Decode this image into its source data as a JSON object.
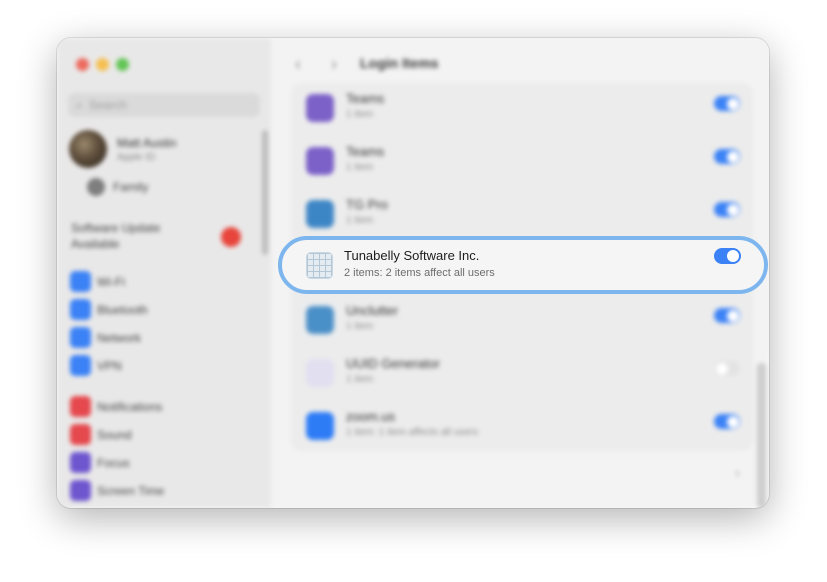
{
  "window": {
    "title": "Login Items"
  },
  "sidebar": {
    "search_placeholder": "Search",
    "account": {
      "name": "Matt Austin",
      "subtitle": "Apple ID"
    },
    "family": "Family",
    "update_text": "Software Update Available",
    "sections": [
      [
        {
          "label": "Wi-Fi",
          "icon": "wifi-icon",
          "color": "#3b82f6"
        },
        {
          "label": "Bluetooth",
          "icon": "bluetooth-icon",
          "color": "#3b82f6"
        },
        {
          "label": "Network",
          "icon": "network-icon",
          "color": "#3b82f6"
        },
        {
          "label": "VPN",
          "icon": "vpn-icon",
          "color": "#3b82f6"
        }
      ],
      [
        {
          "label": "Notifications",
          "icon": "notifications-icon",
          "color": "#e5484d"
        },
        {
          "label": "Sound",
          "icon": "sound-icon",
          "color": "#e5484d"
        },
        {
          "label": "Focus",
          "icon": "focus-icon",
          "color": "#6e56cf"
        },
        {
          "label": "Screen Time",
          "icon": "screen-time-icon",
          "color": "#6e56cf"
        }
      ]
    ]
  },
  "login_items": [
    {
      "name": "Teams",
      "subtitle": "1 item",
      "icon": "teams-icon",
      "icon_color": "#7b61c8",
      "enabled": true
    },
    {
      "name": "Teams",
      "subtitle": "1 item",
      "icon": "teams-icon",
      "icon_color": "#7b61c8",
      "enabled": true
    },
    {
      "name": "TG Pro",
      "subtitle": "1 item",
      "icon": "tg-pro-icon",
      "icon_color": "#3d86c6",
      "enabled": true
    },
    {
      "name": "Unclutter",
      "subtitle": "1 item",
      "icon": "unclutter-icon",
      "icon_color": "#4a90c8",
      "enabled": true
    },
    {
      "name": "UUID Generator",
      "subtitle": "1 item",
      "icon": "uuid-generator-icon",
      "icon_color": "#e2dff0",
      "enabled": false
    },
    {
      "name": "zoom.us",
      "subtitle": "1 item: 1 item affects all users",
      "icon": "zoom-icon",
      "icon_color": "#2d7cf6",
      "enabled": true
    }
  ],
  "highlighted_item": {
    "name": "Tunabelly Software Inc.",
    "subtitle": "2 items: 2 items affect all users",
    "icon": "app-placeholder-icon",
    "enabled": true
  },
  "colors": {
    "accent": "#3b82f6",
    "highlight_ring": "#7db6ee"
  }
}
